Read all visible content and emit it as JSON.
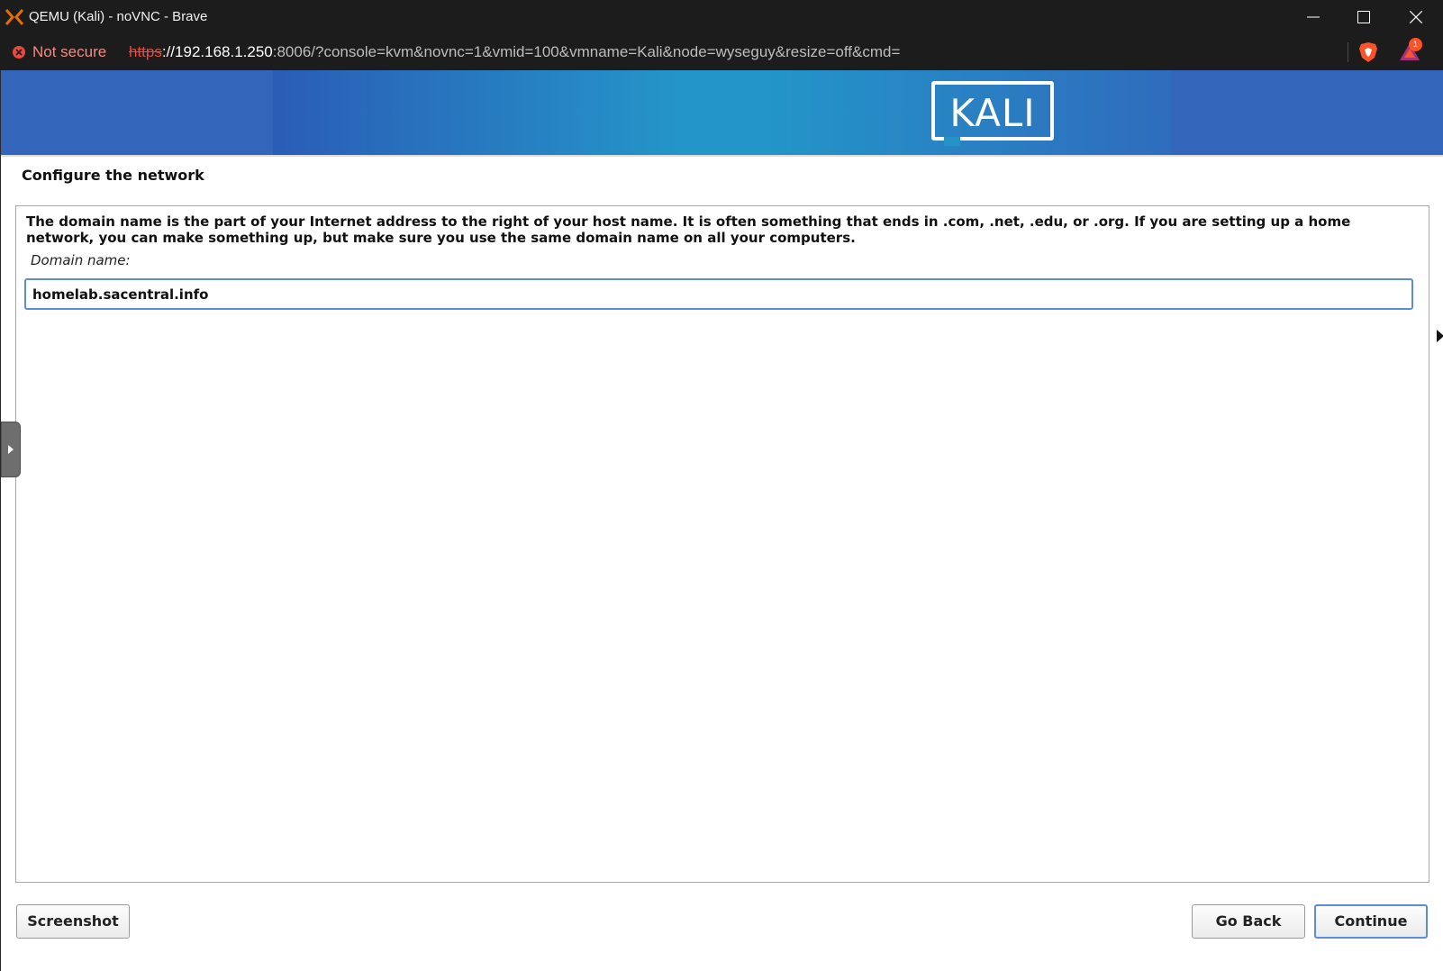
{
  "window": {
    "title": "QEMU (Kali) - noVNC - Brave",
    "controls": {
      "minimize": "minimize",
      "maximize": "maximize",
      "close": "close"
    }
  },
  "addressbar": {
    "security_label": "Not secure",
    "url_scheme": "https",
    "url_host": "://192.168.1.250",
    "url_rest": ":8006/?console=kvm&novnc=1&vmid=100&vmname=Kali&node=wyseguy&resize=off&cmd=",
    "rewards_badge": "1"
  },
  "installer": {
    "logo_text": "KALI",
    "step_title": "Configure the network",
    "description": "The domain name is the part of your Internet address to the right of your host name.  It is often something that ends in .com, .net, .edu, or .org.  If you are setting up a home network, you can make something up, but make sure you use the same domain name on all your computers.",
    "field_label": "Domain name:",
    "domain_value": "homelab.sacentral.info",
    "buttons": {
      "screenshot": "Screenshot",
      "go_back": "Go Back",
      "continue": "Continue"
    }
  },
  "colors": {
    "chrome_bg": "#1c1c1c",
    "banner_blue": "#3366bb",
    "banner_teal": "#2495c8",
    "focus_blue": "#5b8ed6",
    "not_secure_red": "#f28b82",
    "brave_orange": "#fb542b"
  }
}
